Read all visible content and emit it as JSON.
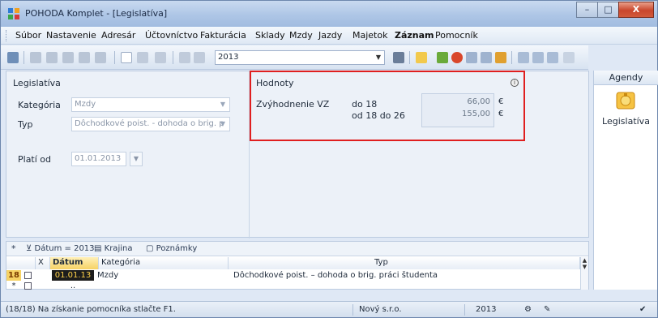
{
  "window": {
    "title": "POHODA Komplet - [Legislatíva]",
    "controls": {
      "minimize": "–",
      "maximize": "□",
      "close": "X"
    }
  },
  "menu": {
    "items": [
      {
        "label": "Súbor"
      },
      {
        "label": "Nastavenie"
      },
      {
        "label": "Adresár"
      },
      {
        "label": "Účtovníctvo"
      },
      {
        "label": "Fakturácia"
      },
      {
        "label": "Sklady"
      },
      {
        "label": "Mzdy"
      },
      {
        "label": "Jazdy"
      },
      {
        "label": "Majetok"
      },
      {
        "label": "Záznam"
      },
      {
        "label": "Pomocník"
      }
    ]
  },
  "toolbar": {
    "year_value": "2013",
    "icons": [
      "agenda-icon",
      "print-icon",
      "print-preview-icon",
      "copy-icon",
      "paste-icon",
      "new-record-icon",
      "edit-icon",
      "delete-icon",
      "save-icon",
      "cancel-icon",
      "duplicate-icon"
    ],
    "right_icons": [
      "filter-icon",
      "folder-icon",
      "tools-icon",
      "globe-icon",
      "calendar-icon",
      "list-icon",
      "users-icon",
      "window-icon",
      "window-icon-2",
      "window-icon-3",
      "help-icon"
    ]
  },
  "legislativa": {
    "title": "Legislatíva",
    "kategoria_label": "Kategória",
    "kategoria_value": "Mzdy",
    "typ_label": "Typ",
    "typ_value": "Dôchodkové poist. - dohoda o brig. p",
    "plati_od_label": "Platí od",
    "plati_od_value": "01.01.2013"
  },
  "hodnoty": {
    "title": "Hodnoty",
    "row_label": "Zvýhodnenie VZ",
    "lines": [
      {
        "range": "do 18",
        "value": "66,00",
        "currency": "€"
      },
      {
        "range": "od 18 do 26",
        "value": "155,00",
        "currency": "€"
      }
    ]
  },
  "agendy": {
    "title": "Agendy",
    "items": [
      {
        "label": "Legislatíva",
        "icon": "legislativa-icon"
      }
    ]
  },
  "filterbar": {
    "star": "*",
    "filters": [
      {
        "label": "Dátum = 2013",
        "icon": "filter-icon"
      },
      {
        "label": "Krajina",
        "icon": "table-icon"
      },
      {
        "label": "Poznámky",
        "icon": "note-icon"
      }
    ]
  },
  "grid": {
    "columns": {
      "x": "X",
      "datum": "Dátum",
      "kategoria": "Kategória",
      "typ": "Typ"
    },
    "rows": [
      {
        "num": "18",
        "datum": "01.01.13",
        "kategoria": "Mzdy",
        "typ": "Dôchodkové poist. – dohoda o brig. práci študenta"
      },
      {
        "num": "*",
        "datum": "..",
        "kategoria": "",
        "typ": ""
      }
    ]
  },
  "statusbar": {
    "message": "(18/18) Na získanie pomocníka stlačte F1.",
    "company": "Nový s.r.o.",
    "year": "2013"
  }
}
